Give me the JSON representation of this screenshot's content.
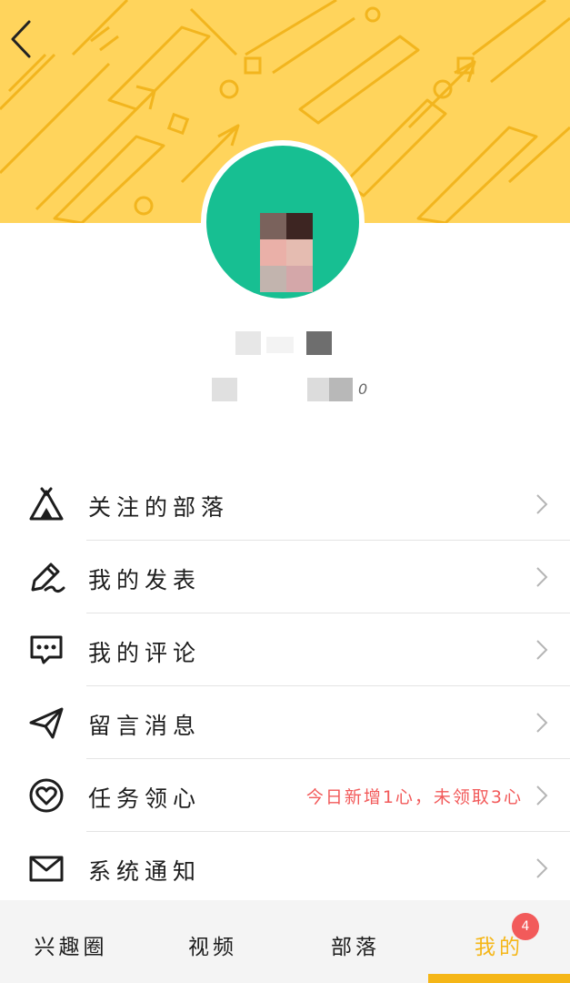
{
  "header": {
    "back_icon": "chevron-left-icon",
    "colors": {
      "banner": "#FFD45C",
      "pattern": "#F2B51E",
      "avatar": "#17BF92"
    }
  },
  "profile": {
    "stats_count": "0"
  },
  "menu": {
    "items": [
      {
        "label": "关注的部落",
        "icon": "tent-icon"
      },
      {
        "label": "我的发表",
        "icon": "pencil-icon"
      },
      {
        "label": "我的评论",
        "icon": "chat-bubble-icon"
      },
      {
        "label": "留言消息",
        "icon": "paper-plane-icon"
      },
      {
        "label": "任务领心",
        "icon": "heart-icon",
        "note": "今日新增1心，未领取3心"
      },
      {
        "label": "系统通知",
        "icon": "envelope-icon"
      }
    ]
  },
  "tabbar": {
    "accent": "#F5B617",
    "tabs": [
      {
        "label": "兴趣圈"
      },
      {
        "label": "视频"
      },
      {
        "label": "部落"
      },
      {
        "label": "我的",
        "badge": "4",
        "active": true
      }
    ]
  }
}
